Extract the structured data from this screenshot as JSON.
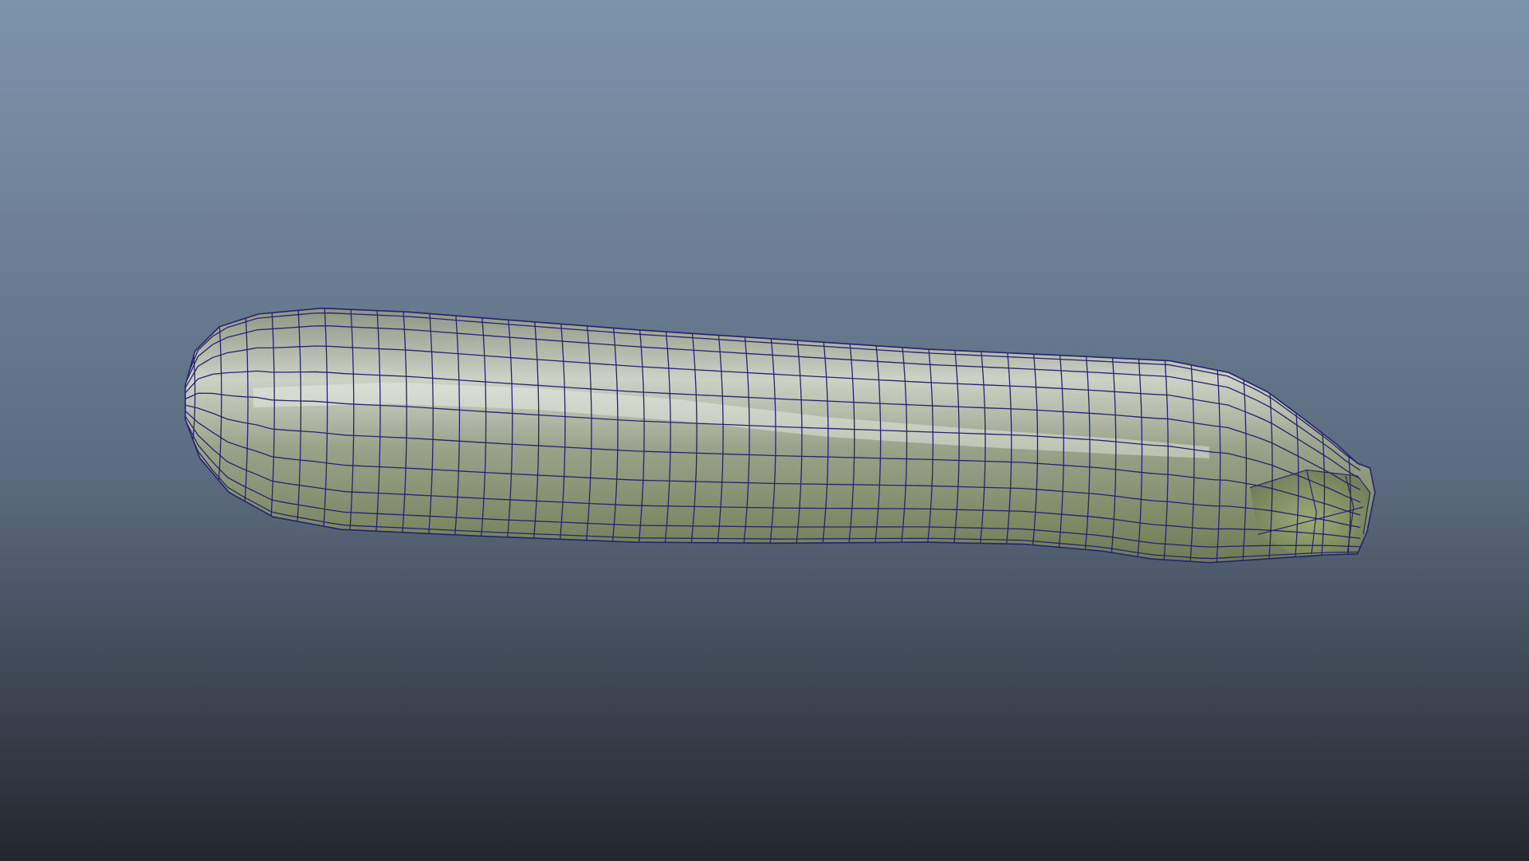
{
  "viewport": {
    "background_top": "#7d93ac",
    "background_mid": "#5c6c80",
    "background_bottom": "#23272d"
  },
  "model": {
    "object": "zucchini",
    "display_mode": "wireframe-on-shaded",
    "wire_color": "#23236e",
    "skin_light": "#cdd1c6",
    "skin_mid": "#9aa28a",
    "skin_dark": "#6f7a58",
    "stem_color": "#8a9a5e"
  }
}
